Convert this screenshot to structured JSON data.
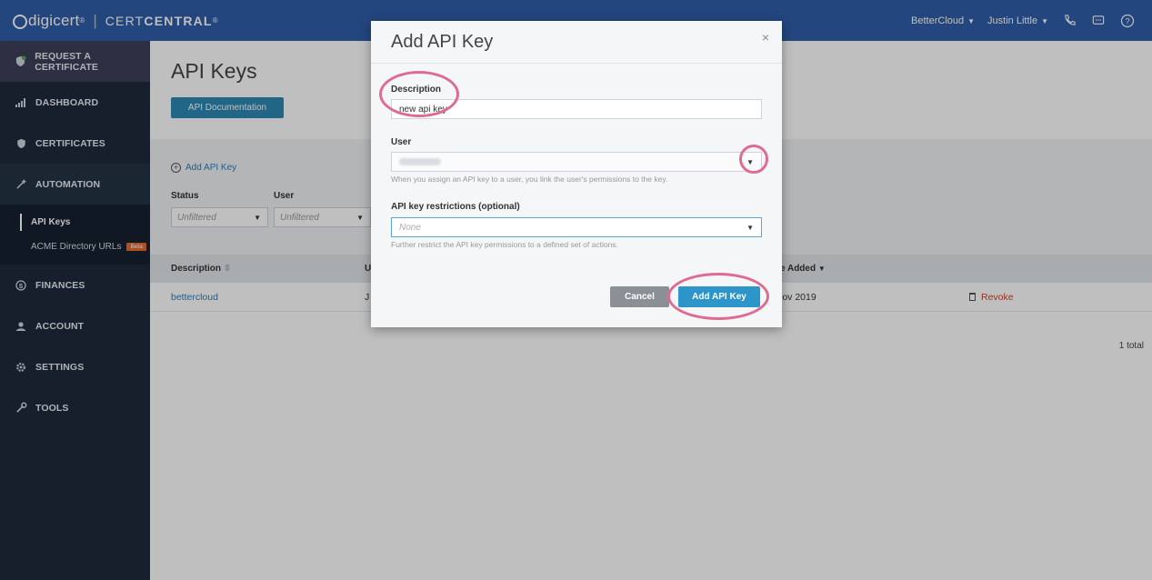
{
  "header": {
    "brand": "digicert",
    "brand_mark": "®",
    "separator": "|",
    "product_light": "CERT",
    "product_bold": "CENTRAL",
    "product_mark": "®",
    "org_menu": "BetterCloud",
    "user_menu": "Justin Little",
    "icons": [
      "phone-icon",
      "chat-icon",
      "help-icon"
    ]
  },
  "sidebar": {
    "items": [
      {
        "label": "REQUEST A CERTIFICATE",
        "icon": "shield-plus-icon"
      },
      {
        "label": "DASHBOARD",
        "icon": "bar-chart-icon"
      },
      {
        "label": "CERTIFICATES",
        "icon": "shield-icon"
      },
      {
        "label": "AUTOMATION",
        "icon": "wand-icon"
      },
      {
        "label": "FINANCES",
        "icon": "dollar-icon"
      },
      {
        "label": "ACCOUNT",
        "icon": "user-icon"
      },
      {
        "label": "SETTINGS",
        "icon": "gear-icon"
      },
      {
        "label": "TOOLS",
        "icon": "wrench-icon"
      }
    ],
    "sub_items": [
      {
        "label": "API Keys"
      },
      {
        "label": "ACME Directory URLs",
        "badge": "Beta"
      }
    ]
  },
  "page": {
    "title": "API Keys",
    "doc_button": "API Documentation",
    "add_link": "Add API Key",
    "filters": {
      "status_label": "Status",
      "status_value": "Unfiltered",
      "user_label": "User",
      "user_value": "Unfiltered"
    },
    "table": {
      "col_description": "Description",
      "col_user_partial": "U",
      "col_date_partial": "e Added",
      "rows": [
        {
          "description": "bettercloud",
          "user_partial": "J",
          "date_partial": "lov 2019",
          "action": "Revoke"
        }
      ],
      "total": "1 total"
    }
  },
  "modal": {
    "title": "Add API Key",
    "close": "×",
    "description_label": "Description",
    "description_value": "new api key",
    "user_label": "User",
    "user_help": "When you assign an API key to a user, you link the user's permissions to the key.",
    "restrictions_label": "API key restrictions (optional)",
    "restrictions_placeholder": "None",
    "restrictions_help": "Further restrict the API key permissions to a defined set of actions.",
    "cancel_button": "Cancel",
    "add_button": "Add API Key"
  },
  "colors": {
    "topbar": "#2f5ea8",
    "sidebar": "#1e2a3a",
    "primary_button": "#2d95c9",
    "annotation_ring": "#de6c92",
    "revoke": "#c9432b"
  }
}
